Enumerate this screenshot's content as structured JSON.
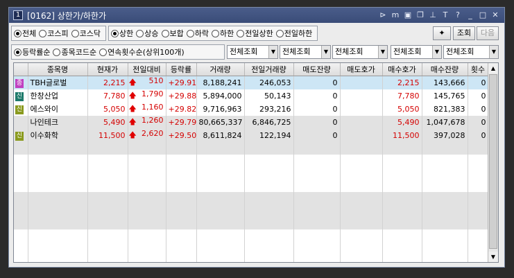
{
  "window": {
    "number": "1",
    "title": "[0162] 상한가/하한가"
  },
  "title_icons": [
    "link-icon",
    "m-icon",
    "layout-icon",
    "copy-icon",
    "pin-icon",
    "font-icon",
    "help-icon",
    "minimize-icon",
    "maximize-icon",
    "close-icon"
  ],
  "market": {
    "options": [
      "전체",
      "코스피",
      "코스닥"
    ],
    "selected": 0
  },
  "condition": {
    "options": [
      "상한",
      "상승",
      "보합",
      "하락",
      "하한",
      "전일상한",
      "전일하한"
    ],
    "selected": 0
  },
  "sort": {
    "options": [
      "등락률순",
      "종목코드순",
      "연속횟수순(상위100개)"
    ],
    "selected": 0
  },
  "buttons": {
    "query": "조회",
    "next": "다음"
  },
  "filters": [
    "전체조회",
    "전체조회",
    "전체조회",
    "전체조회",
    "전체조회"
  ],
  "columns": [
    "종목명",
    "현재가",
    "전일대비",
    "등락률",
    "거래량",
    "전일거래량",
    "매도잔량",
    "매도호가",
    "매수호가",
    "매수잔량",
    "횟수"
  ],
  "rows": [
    {
      "mark": "종",
      "mark_color": "#c040c0",
      "name": "TBH글로벌",
      "price": "2,215",
      "diff": "510",
      "rate": "+29.91",
      "volume": "8,188,241",
      "prev_volume": "246,053",
      "ask_qty": "0",
      "ask": "",
      "bid": "2,215",
      "bid_qty": "143,666",
      "count": "0"
    },
    {
      "mark": "신",
      "mark_color": "#1e7a6a",
      "name": "한창산업",
      "price": "7,780",
      "diff": "1,790",
      "rate": "+29.88",
      "volume": "5,894,000",
      "prev_volume": "50,143",
      "ask_qty": "0",
      "ask": "",
      "bid": "7,780",
      "bid_qty": "145,765",
      "count": "0"
    },
    {
      "mark": "신",
      "mark_color": "#8a9a1e",
      "name": "에스와이",
      "price": "5,050",
      "diff": "1,160",
      "rate": "+29.82",
      "volume": "9,716,963",
      "prev_volume": "293,216",
      "ask_qty": "0",
      "ask": "",
      "bid": "5,050",
      "bid_qty": "821,383",
      "count": "0"
    },
    {
      "mark": "",
      "mark_color": "",
      "name": "나인테크",
      "price": "5,490",
      "diff": "1,260",
      "rate": "+29.79",
      "volume": "80,665,337",
      "prev_volume": "6,846,725",
      "ask_qty": "0",
      "ask": "",
      "bid": "5,490",
      "bid_qty": "1,047,678",
      "count": "0"
    },
    {
      "mark": "신",
      "mark_color": "#8a9a1e",
      "name": "이수화학",
      "price": "11,500",
      "diff": "2,620",
      "rate": "+29.50",
      "volume": "8,611,824",
      "prev_volume": "122,194",
      "ask_qty": "0",
      "ask": "",
      "bid": "11,500",
      "bid_qty": "397,028",
      "count": "0"
    }
  ]
}
